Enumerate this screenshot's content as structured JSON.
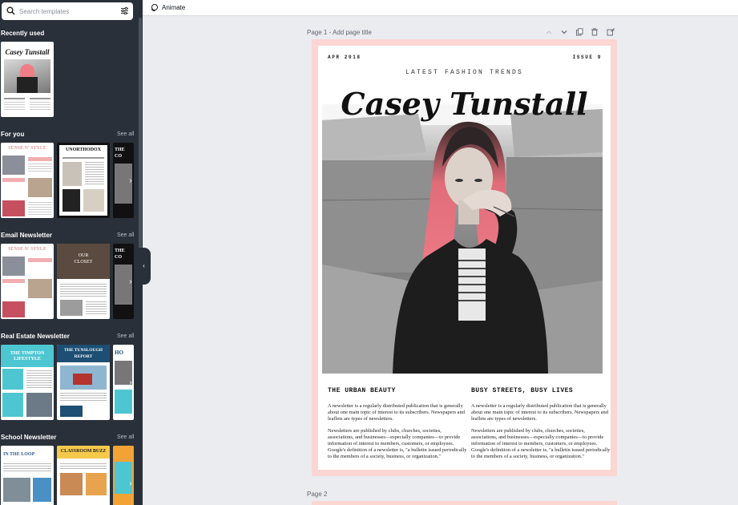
{
  "search": {
    "placeholder": "Search templates"
  },
  "icons": {
    "search": "search-icon",
    "filter": "sliders-icon",
    "collapse": "chevron-left-icon",
    "next": "chevron-right-icon",
    "animate": "animate-icon",
    "up": "chevron-up-icon",
    "down": "chevron-down-icon",
    "duplicate": "copy-icon",
    "delete": "trash-icon",
    "add": "add-page-icon"
  },
  "sidebar": {
    "sections": [
      {
        "title": "Recently used",
        "see_all": ""
      },
      {
        "title": "For you",
        "see_all": "See all"
      },
      {
        "title": "Email Newsletter",
        "see_all": "See all"
      },
      {
        "title": "Real Estate Newsletter",
        "see_all": "See all"
      },
      {
        "title": "School Newsletter",
        "see_all": "See all"
      }
    ],
    "thumb_text": {
      "casey": "Casey Tunstall",
      "sense": "SENSE N' STYLE",
      "unorthodox": "UNORTHODOX",
      "the": "THE",
      "co": "CO",
      "our": "OUR",
      "closet": "CLOSET",
      "timpton1": "THE TIMPTON",
      "timpton2": "LIFESTYLE",
      "tunslough1": "THE TUNSLOUGH",
      "tunslough2": "REPORT",
      "ho": "HO",
      "loop1": "IN THE LOOP",
      "classroom": "CLASSROOM BUZZ"
    }
  },
  "toolbar": {
    "animate_label": "Animate"
  },
  "canvas": {
    "page1_label": "Page 1 - Add page title",
    "page2_label": "Page 2"
  },
  "newsletter": {
    "date": "APR 2018",
    "issue": "ISSUE 9",
    "kicker": "LATEST FASHION TRENDS",
    "masthead": "Casey Tunstall",
    "left_heading": "THE URBAN BEAUTY",
    "right_heading": "BUSY STREETS, BUSY LIVES",
    "para1": "A newsletter is a regularly distributed publication that is generally about one main topic of interest to its subscribers. Newspapers and leaflets are types of newsletters.",
    "para2": "Newsletters are published by clubs, churches, societies, associations, and businesses—especially companies—to provide information of interest to members, customers, or employees. Google's definition of a newsletter is, \"a bulletin issued periodically to the members of a society, business, or organization.\""
  },
  "colors": {
    "sidebar": "#293039",
    "canvas": "#ebecf0",
    "page_border": "#fbd6d3",
    "hair": "#ee7e86"
  }
}
